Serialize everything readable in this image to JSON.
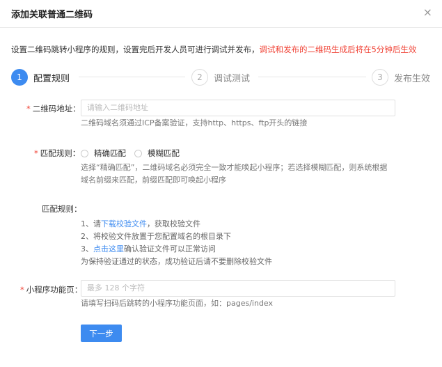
{
  "dialog": {
    "title": "添加关联普通二维码",
    "close": "×"
  },
  "intro": {
    "text": "设置二维码跳转小程序的规则，设置完后开发人员可进行调试并发布，",
    "warning": "调试和发布的二维码生成后将在5分钟后生效"
  },
  "steps": [
    {
      "num": "1",
      "label": "配置规则"
    },
    {
      "num": "2",
      "label": "调试测试"
    },
    {
      "num": "3",
      "label": "发布生效"
    }
  ],
  "qr_url": {
    "required": "*",
    "label": "二维码地址：",
    "placeholder": "请输入二维码地址",
    "hint": "二维码域名须通过ICP备案验证，支持http、https、ftp开头的链接"
  },
  "match_rule": {
    "required": "*",
    "label": "匹配规则：",
    "options": [
      "精确匹配",
      "模糊匹配"
    ],
    "hint_line1": "选择“精确匹配”，二维码域名必须完全一致才能唤起小程序；若选择模糊匹配，则系统根据",
    "hint_line2": "域名前缀来匹配，前缀匹配即可唤起小程序"
  },
  "verify": {
    "label": "匹配规则：",
    "l1_prefix": "1、请",
    "l1_link": "下载校验文件",
    "l1_suffix": "，获取校验文件",
    "l2": "2、将校验文件放置于您配置域名的根目录下",
    "l3_prefix": "3、",
    "l3_link": "点击这里",
    "l3_suffix": "确认验证文件可以正常访问",
    "l4": "为保持验证通过的状态，成功验证后请不要删除校验文件"
  },
  "page_field": {
    "required": "*",
    "label": "小程序功能页：",
    "placeholder": "最多 128 个字符",
    "hint": "请填写扫码后跳转的小程序功能页面，如：pages/index"
  },
  "next_button": "下一步",
  "colors": {
    "accent": "#3d8bf0",
    "warning": "#f04134"
  }
}
